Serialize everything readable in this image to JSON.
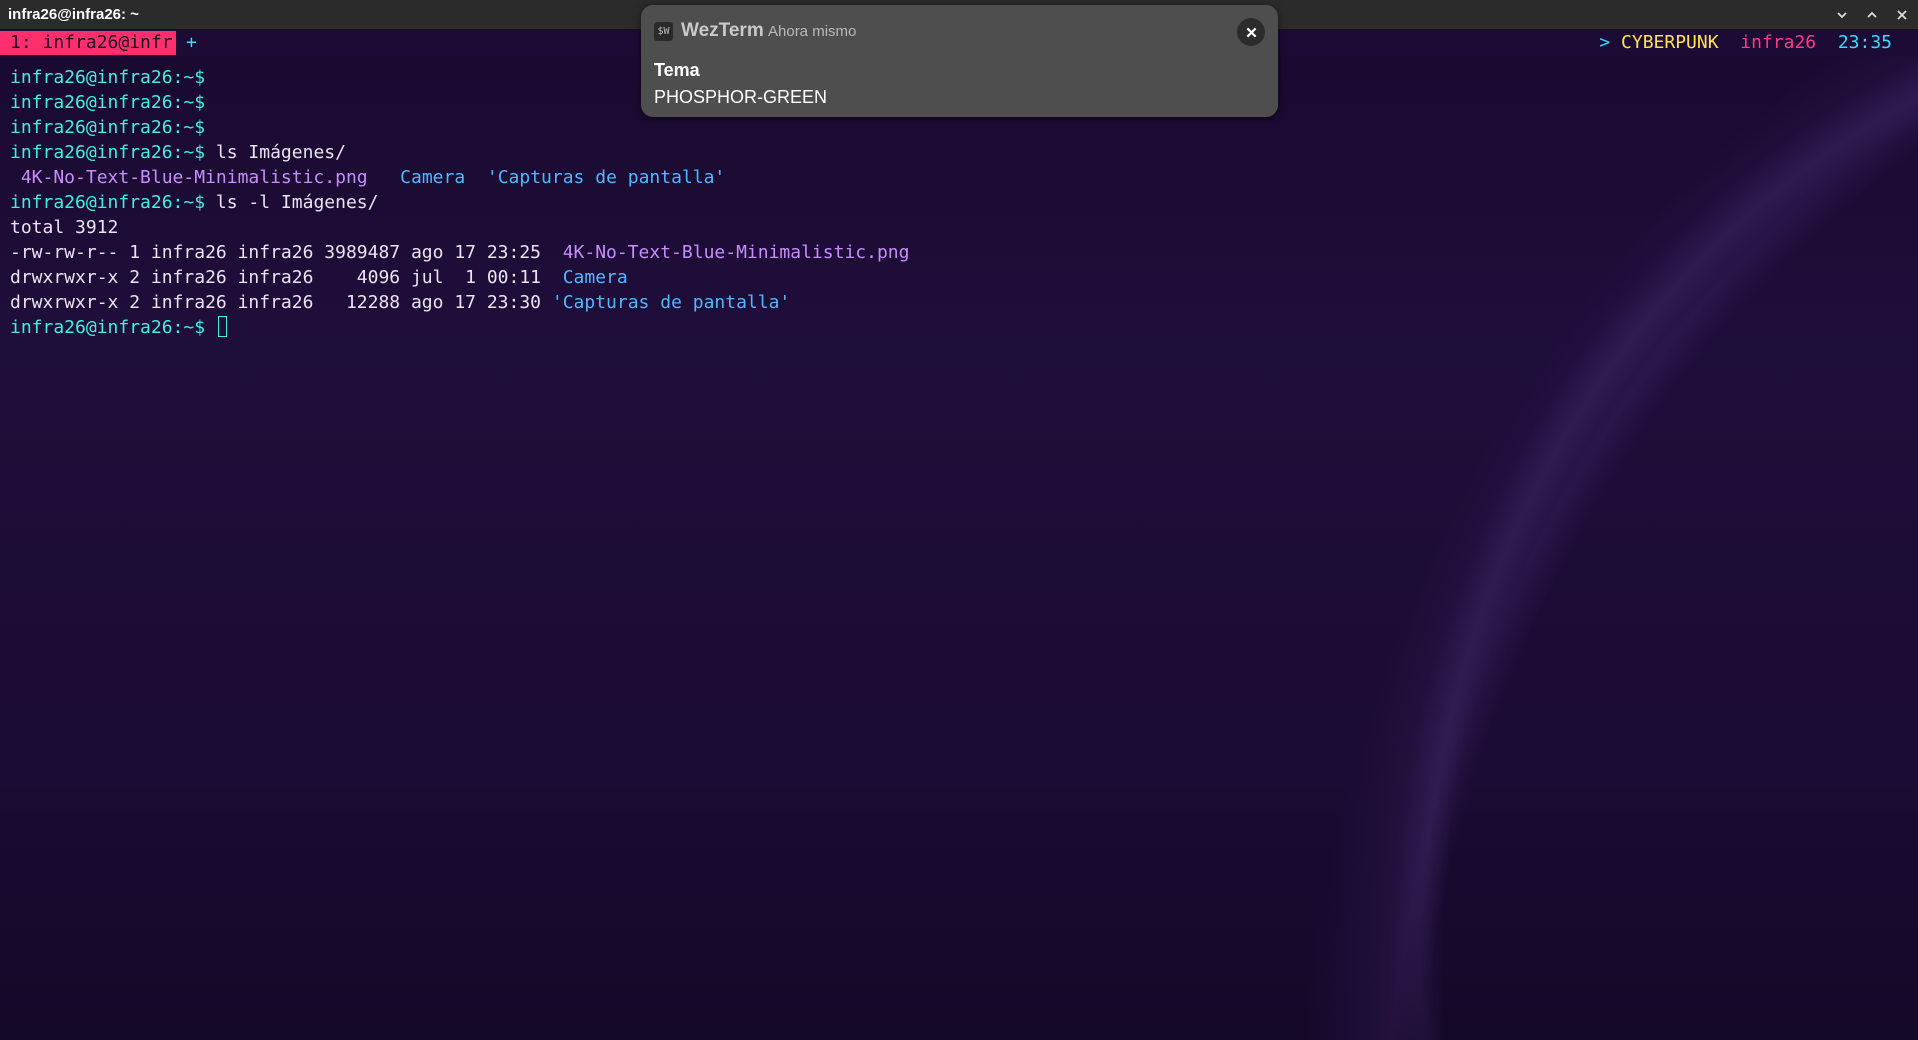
{
  "window": {
    "title": "infra26@infra26: ~",
    "controls": {
      "minimize_icon": "chevron-down-icon",
      "maximize_icon": "chevron-up-icon",
      "close_icon": "close-icon"
    }
  },
  "tabbar": {
    "active_tab_label": "1: infra26@infr",
    "new_tab_label": "+",
    "status": {
      "arrow": ">",
      "theme": "CYBERPUNK",
      "host": "infra26",
      "time": "23:35"
    }
  },
  "notification": {
    "app_icon": "$W",
    "app_name": "WezTerm",
    "time": "Ahora mismo",
    "title": "Tema",
    "body": "PHOSPHOR-GREEN",
    "close_icon": "close-icon"
  },
  "terminal": {
    "prompt": "infra26@infra26:~$",
    "lines": [
      {
        "type": "prompt",
        "cmd": ""
      },
      {
        "type": "prompt",
        "cmd": ""
      },
      {
        "type": "prompt",
        "cmd": ""
      },
      {
        "type": "prompt",
        "cmd": " ls Imágenes/"
      },
      {
        "type": "ls",
        "items": [
          {
            "text": " 4K-No-Text-Blue-Minimalistic.png",
            "kind": "img"
          },
          {
            "text": "   ",
            "kind": "plain"
          },
          {
            "text": "Camera",
            "kind": "dir"
          },
          {
            "text": "  ",
            "kind": "plain"
          },
          {
            "text": "'Capturas de pantalla'",
            "kind": "dir"
          }
        ]
      },
      {
        "type": "prompt",
        "cmd": " ls -l Imágenes/"
      },
      {
        "type": "text",
        "text": "total 3912"
      },
      {
        "type": "ls",
        "items": [
          {
            "text": "-rw-rw-r-- 1 infra26 infra26 3989487 ago 17 23:25  ",
            "kind": "plain"
          },
          {
            "text": "4K-No-Text-Blue-Minimalistic.png",
            "kind": "img"
          }
        ]
      },
      {
        "type": "ls",
        "items": [
          {
            "text": "drwxrwxr-x 2 infra26 infra26    4096 jul  1 00:11  ",
            "kind": "plain"
          },
          {
            "text": "Camera",
            "kind": "dir"
          }
        ]
      },
      {
        "type": "ls",
        "items": [
          {
            "text": "drwxrwxr-x 2 infra26 infra26   12288 ago 17 23:30 ",
            "kind": "plain"
          },
          {
            "text": "'Capturas de pantalla'",
            "kind": "dir"
          }
        ]
      },
      {
        "type": "prompt",
        "cmd": " ",
        "cursor": true
      }
    ]
  }
}
